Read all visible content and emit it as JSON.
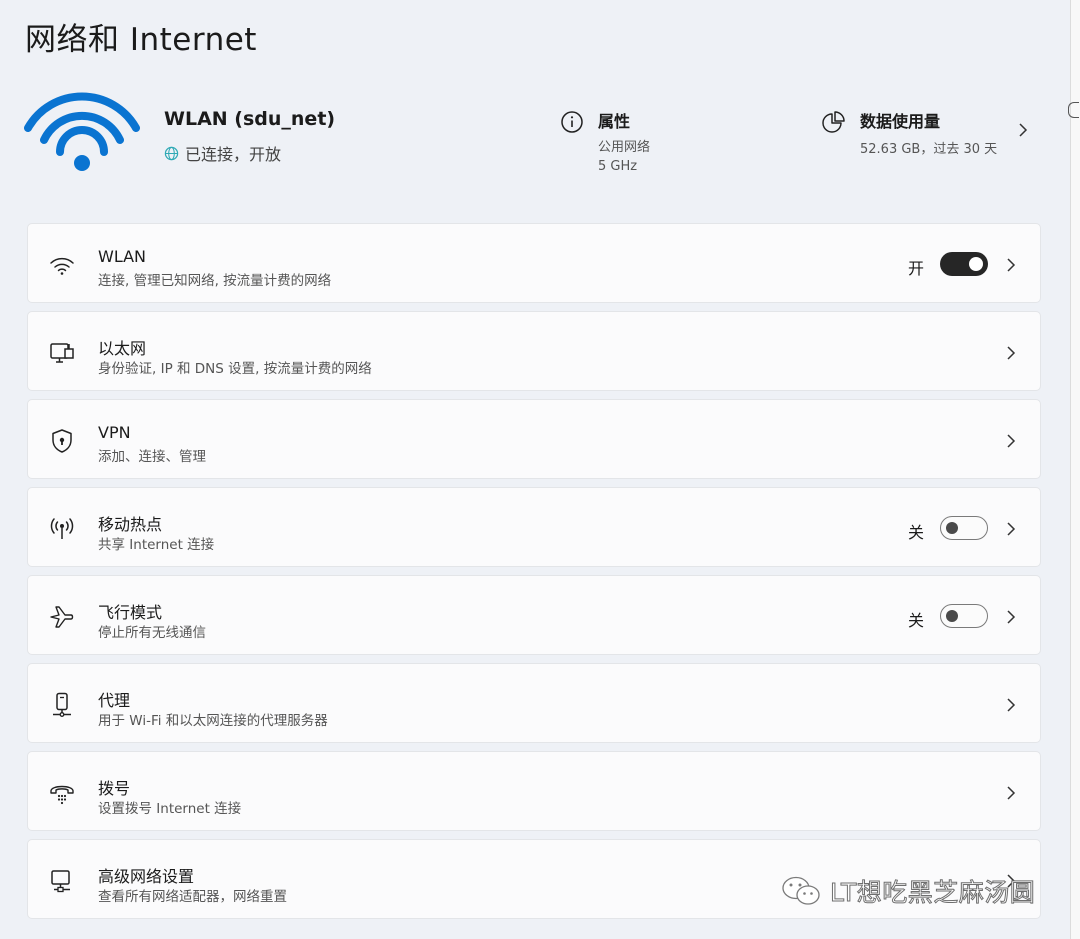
{
  "page": {
    "title": "网络和 Internet"
  },
  "network": {
    "name": "WLAN (sdu_net)",
    "status": "已连接，开放",
    "properties": {
      "title": "属性",
      "line1": "公用网络",
      "line2": "5 GHz"
    },
    "data_usage": {
      "title": "数据使用量",
      "subtitle": "52.63 GB，过去 30 天"
    }
  },
  "rows": [
    {
      "label": "WLAN",
      "sub": "连接, 管理已知网络, 按流量计费的网络",
      "state": "开",
      "toggle": "on",
      "icon": "wifi-icon"
    },
    {
      "label": "以太网",
      "sub": "身份验证, IP 和 DNS 设置, 按流量计费的网络",
      "icon": "ethernet-icon"
    },
    {
      "label": "VPN",
      "sub": "添加、连接、管理",
      "icon": "shield-lock-icon"
    },
    {
      "label": "移动热点",
      "sub": "共享 Internet 连接",
      "state": "关",
      "toggle": "off",
      "icon": "hotspot-icon"
    },
    {
      "label": "飞行模式",
      "sub": "停止所有无线通信",
      "state": "关",
      "toggle": "off",
      "icon": "airplane-icon"
    },
    {
      "label": "代理",
      "sub": "用于 Wi-Fi 和以太网连接的代理服务器",
      "icon": "proxy-icon"
    },
    {
      "label": "拨号",
      "sub": "设置拨号 Internet 连接",
      "icon": "dialup-icon"
    },
    {
      "label": "高级网络设置",
      "sub": "查看所有网络适配器，网络重置",
      "icon": "monitor-network-icon"
    }
  ],
  "watermark": {
    "text": "LT想吃黑芝麻汤圆"
  },
  "colors": {
    "accent": "#0a74d1",
    "background": "#eef1f6",
    "card": "#fbfbfc",
    "toggle_on": "#262626"
  }
}
